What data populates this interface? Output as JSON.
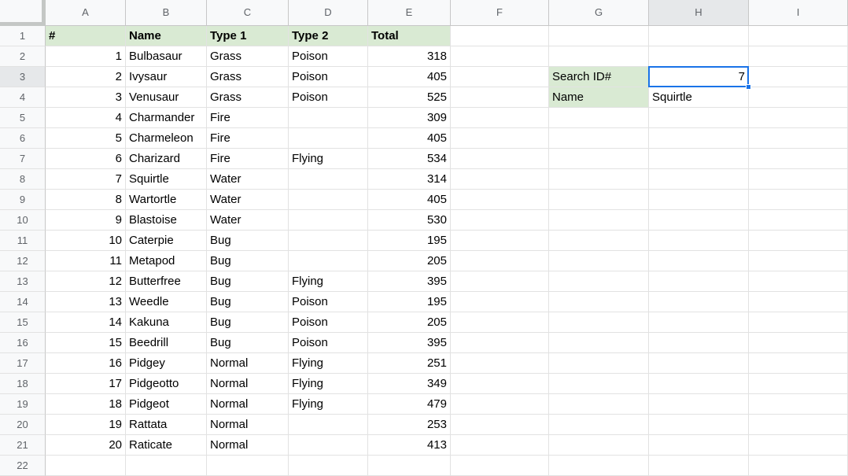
{
  "sheet": {
    "column_headers": [
      "A",
      "B",
      "C",
      "D",
      "E",
      "F",
      "G",
      "H",
      "I"
    ],
    "row_headers": [
      "1",
      "2",
      "3",
      "4",
      "5",
      "6",
      "7",
      "8",
      "9",
      "10",
      "11",
      "12",
      "13",
      "14",
      "15",
      "16",
      "17",
      "18",
      "19",
      "20",
      "21",
      "22"
    ],
    "selected": {
      "column": "H",
      "row": "3"
    },
    "table": {
      "headers": [
        "#",
        "Name",
        "Type 1",
        "Type 2",
        "Total"
      ],
      "rows": [
        [
          1,
          "Bulbasaur",
          "Grass",
          "Poison",
          318
        ],
        [
          2,
          "Ivysaur",
          "Grass",
          "Poison",
          405
        ],
        [
          3,
          "Venusaur",
          "Grass",
          "Poison",
          525
        ],
        [
          4,
          "Charmander",
          "Fire",
          "",
          309
        ],
        [
          5,
          "Charmeleon",
          "Fire",
          "",
          405
        ],
        [
          6,
          "Charizard",
          "Fire",
          "Flying",
          534
        ],
        [
          7,
          "Squirtle",
          "Water",
          "",
          314
        ],
        [
          8,
          "Wartortle",
          "Water",
          "",
          405
        ],
        [
          9,
          "Blastoise",
          "Water",
          "",
          530
        ],
        [
          10,
          "Caterpie",
          "Bug",
          "",
          195
        ],
        [
          11,
          "Metapod",
          "Bug",
          "",
          205
        ],
        [
          12,
          "Butterfree",
          "Bug",
          "Flying",
          395
        ],
        [
          13,
          "Weedle",
          "Bug",
          "Poison",
          195
        ],
        [
          14,
          "Kakuna",
          "Bug",
          "Poison",
          205
        ],
        [
          15,
          "Beedrill",
          "Bug",
          "Poison",
          395
        ],
        [
          16,
          "Pidgey",
          "Normal",
          "Flying",
          251
        ],
        [
          17,
          "Pidgeotto",
          "Normal",
          "Flying",
          349
        ],
        [
          18,
          "Pidgeot",
          "Normal",
          "Flying",
          479
        ],
        [
          19,
          "Rattata",
          "Normal",
          "",
          253
        ],
        [
          20,
          "Raticate",
          "Normal",
          "",
          413
        ]
      ]
    },
    "lookup": {
      "search_label": "Search ID#",
      "search_value": 7,
      "name_label": "Name",
      "name_value": "Squirtle"
    },
    "colors": {
      "header_fill_green": "#d9ead3",
      "selection_blue": "#1a73e8",
      "header_bg": "#f8f9fa",
      "active_header_bg": "#e6e8ea",
      "gridline": "#e2e2e2"
    }
  }
}
